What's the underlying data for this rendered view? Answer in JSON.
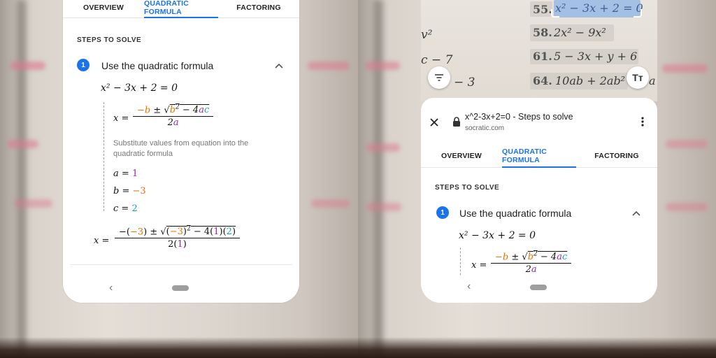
{
  "left_screen": {
    "tabs": [
      {
        "label": "OVERVIEW"
      },
      {
        "label": "QUADRATIC FORMULA"
      },
      {
        "label": "FACTORING"
      }
    ],
    "section_title": "STEPS TO SOLVE",
    "step": {
      "number": "1",
      "title": "Use the quadratic formula"
    },
    "equation": "x² − 3x + 2 = 0",
    "formula_lhs": "x =",
    "formula_num_b": "−b",
    "formula_num_pm": " ± ",
    "formula_num_root": "√",
    "formula_num_b2": "b",
    "formula_num_sq": "2",
    "formula_num_minus4": " − 4",
    "formula_num_a": "a",
    "formula_num_c": "c",
    "formula_den_2": "2",
    "formula_den_a": "a",
    "substitute_note": "Substitute values from equation into the quadratic formula",
    "values": [
      {
        "var": "a",
        "eq": " = ",
        "val": "1"
      },
      {
        "var": "b",
        "eq": " = ",
        "val": "−3"
      },
      {
        "var": "c",
        "eq": " = ",
        "val": "2"
      }
    ],
    "sub_lhs": "x =",
    "sub_num_p1": "−(",
    "sub_num_b": "−3",
    "sub_num_p2": ") ± ",
    "sub_num_root": "√",
    "sub_num_p3": "(",
    "sub_num_b2": "−3",
    "sub_num_p4": ")",
    "sub_num_sq": "2",
    "sub_num_p5": " − 4(",
    "sub_num_a": "1",
    "sub_num_p6": ")(",
    "sub_num_c": "2",
    "sub_num_p7": ")",
    "sub_den_p1": "2(",
    "sub_den_a": "1",
    "sub_den_p2": ")",
    "nav_back": "‹"
  },
  "right_screen": {
    "photo_text": {
      "p55_num": "55.",
      "p55_expr": "x² − 3x + 2 = 0",
      "p58_num": "58.",
      "p58_expr": "2x² − 9x²",
      "p61_num": "61.",
      "p61_expr": "5 − 3x + y + 6",
      "p64_num": "64.",
      "p64_expr": "10ab + 2ab²",
      "p64_tail": "a",
      "left_frag1": "v²",
      "left_frag2": "c − 7",
      "left_frag3": "− 3"
    },
    "text_size_icon_label": "Tт",
    "page_title": "x^2-3x+2=0 - Steps to solve",
    "page_domain": "socratic.com",
    "tabs": [
      {
        "label": "OVERVIEW"
      },
      {
        "label": "QUADRATIC FORMULA"
      },
      {
        "label": "FACTORING"
      }
    ],
    "section_title": "STEPS TO SOLVE",
    "step": {
      "number": "1",
      "title": "Use the quadratic formula"
    },
    "equation": "x² − 3x + 2 = 0",
    "formula_lhs": "x =",
    "formula_num_b": "−b",
    "formula_num_pm": " ± ",
    "formula_num_root": "√",
    "formula_num_b2": "b",
    "formula_num_sq": "2",
    "formula_num_minus4": " − 4",
    "formula_num_a": "a",
    "formula_num_c": "c",
    "formula_den_2": "2",
    "formula_den_a": "a",
    "nav_back": "‹"
  },
  "colors": {
    "accent": "#1a73e8",
    "b_coeff": "#e37400",
    "a_coeff": "#9c27b0",
    "c_coeff": "#12a4a4",
    "highlight": "#8cb4e6"
  }
}
